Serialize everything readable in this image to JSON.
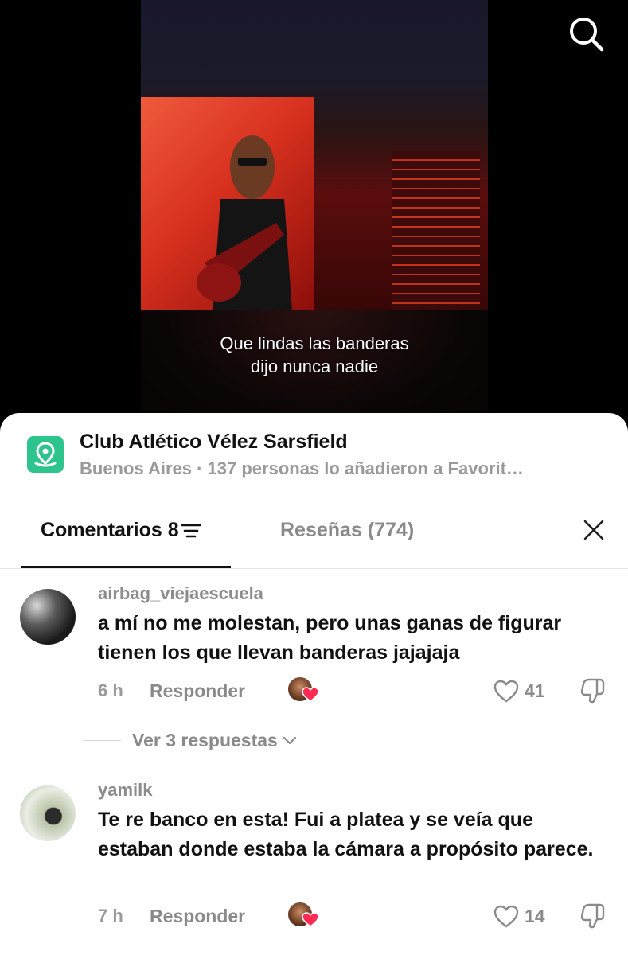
{
  "video": {
    "caption_line1": "Que lindas las banderas",
    "caption_line2": "dijo nunca nadie"
  },
  "place": {
    "name": "Club Atlético Vélez Sarsfield",
    "subtitle": "Buenos Aires · 137 personas lo añadieron a Favorit…",
    "icon": "location-pin-icon",
    "icon_color": "#2ec48d"
  },
  "tabs": {
    "comments_label": "Comentarios 8",
    "reviews_label": "Reseñas (774)"
  },
  "comments": [
    {
      "username": "airbag_viejaescuela",
      "text": "a mí no me molestan, pero unas ganas de figurar tienen los que llevan banderas jajajaja",
      "time": "6 h",
      "reply_label": "Responder",
      "likes": "41"
    },
    {
      "username": "yamilk",
      "text": "Te re banco en esta! Fui a platea y se veía que estaban donde estaba la cámara a propósito parece.",
      "time": "7 h",
      "reply_label": "Responder",
      "likes": "14"
    }
  ],
  "view_replies_label": "Ver 3 respuestas",
  "colors": {
    "accent_heart": "#fe2c55"
  }
}
